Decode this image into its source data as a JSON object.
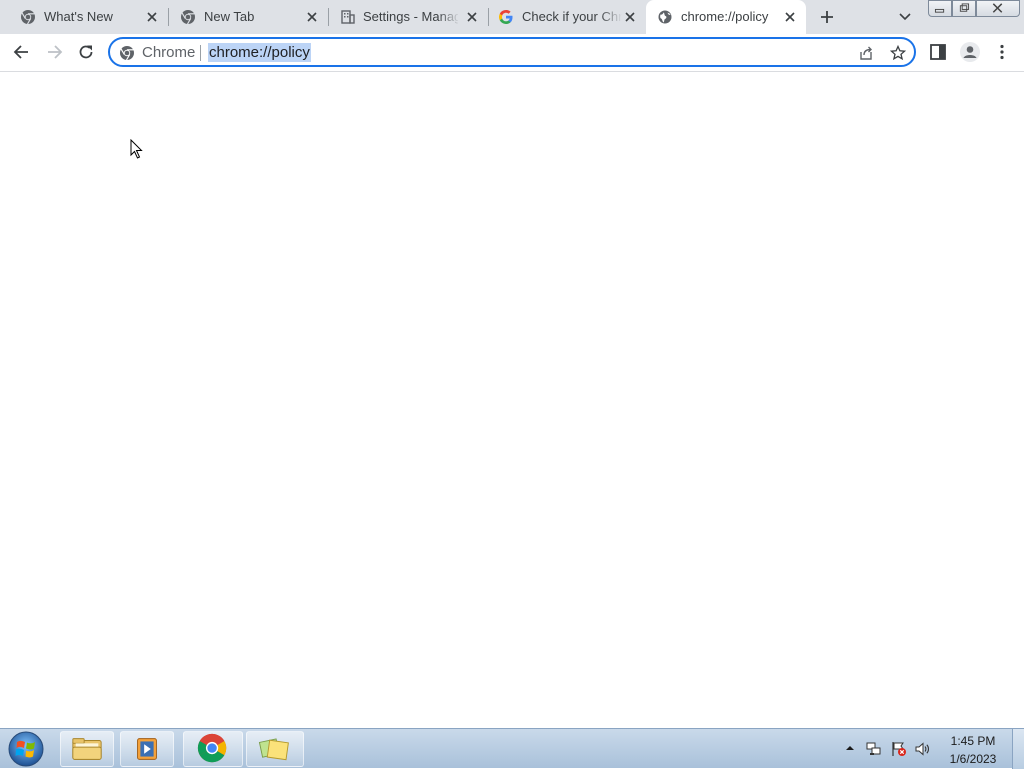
{
  "tabs": [
    {
      "title": "What's New",
      "icon": "chrome-icon",
      "active": false
    },
    {
      "title": "New Tab",
      "icon": "chrome-icon",
      "active": false
    },
    {
      "title": "Settings - Manage",
      "icon": "building-icon",
      "active": false
    },
    {
      "title": "Check if your Chro",
      "icon": "google-icon",
      "active": false
    },
    {
      "title": "chrome://policy",
      "icon": "globe-icon",
      "active": true
    }
  ],
  "omnibox": {
    "chip_label": "Chrome",
    "url": "chrome://policy"
  },
  "taskbar": {
    "time": "1:45 PM",
    "date": "1/6/2023"
  },
  "colors": {
    "tabstrip": "#dee1e6",
    "accent": "#1a73e8",
    "selection": "#bcd4f6",
    "taskbar": "#b9cde2"
  }
}
